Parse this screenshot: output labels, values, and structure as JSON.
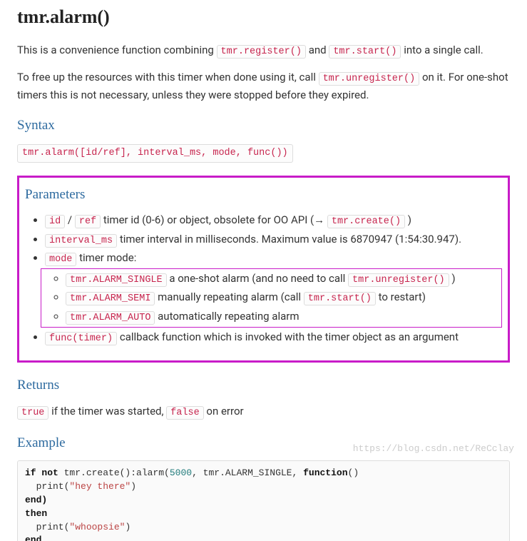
{
  "title": "tmr.alarm()",
  "intro": {
    "pre1": "This is a convenience function combining ",
    "code1": "tmr.register()",
    "mid1": " and ",
    "code2": "tmr.start()",
    "post1": " into a single call."
  },
  "free": {
    "pre": "To free up the resources with this timer when done using it, call ",
    "code": "tmr.unregister()",
    "post": " on it. For one-shot timers this is not necessary, unless they were stopped before they expired."
  },
  "syntax": {
    "heading": "Syntax",
    "code": "tmr.alarm([id/ref], interval_ms, mode, func())"
  },
  "params": {
    "heading": "Parameters",
    "id_code1": "id",
    "id_slash": " / ",
    "id_code2": "ref",
    "id_text1": " timer id (0-6) or object, obsolete for OO API (→ ",
    "id_code3": "tmr.create()",
    "id_text2": " )",
    "interval_code": "interval_ms",
    "interval_text": " timer interval in milliseconds. Maximum value is 6870947 (1:54:30.947).",
    "mode_code": "mode",
    "mode_text": " timer mode:",
    "modes": {
      "single_code": "tmr.ALARM_SINGLE",
      "single_text1": " a one-shot alarm (and no need to call ",
      "single_code2": "tmr.unregister()",
      "single_text2": " )",
      "semi_code": "tmr.ALARM_SEMI",
      "semi_text1": " manually repeating alarm (call ",
      "semi_code2": "tmr.start()",
      "semi_text2": " to restart)",
      "auto_code": "tmr.ALARM_AUTO",
      "auto_text": " automatically repeating alarm"
    },
    "func_code": "func(timer)",
    "func_text": " callback function which is invoked with the timer object as an argument"
  },
  "returns": {
    "heading": "Returns",
    "code1": "true",
    "text1": " if the timer was started, ",
    "code2": "false",
    "text2": " on error"
  },
  "example": {
    "heading": "Example",
    "line1_if": "if not",
    "line1_rest": " tmr.create():alarm(",
    "line1_num": "5000",
    "line1_rest2": ", tmr.ALARM_SINGLE, ",
    "line1_fn": "function",
    "line1_paren": "()",
    "line2_indent": "  print(",
    "line2_str": "\"hey there\"",
    "line2_close": ")",
    "line3": "end)",
    "line4": "then",
    "line5_indent": "  print(",
    "line5_str": "\"whoopsie\"",
    "line5_close": ")",
    "line6": "end"
  },
  "watermark": "https://blog.csdn.net/ReCclay"
}
